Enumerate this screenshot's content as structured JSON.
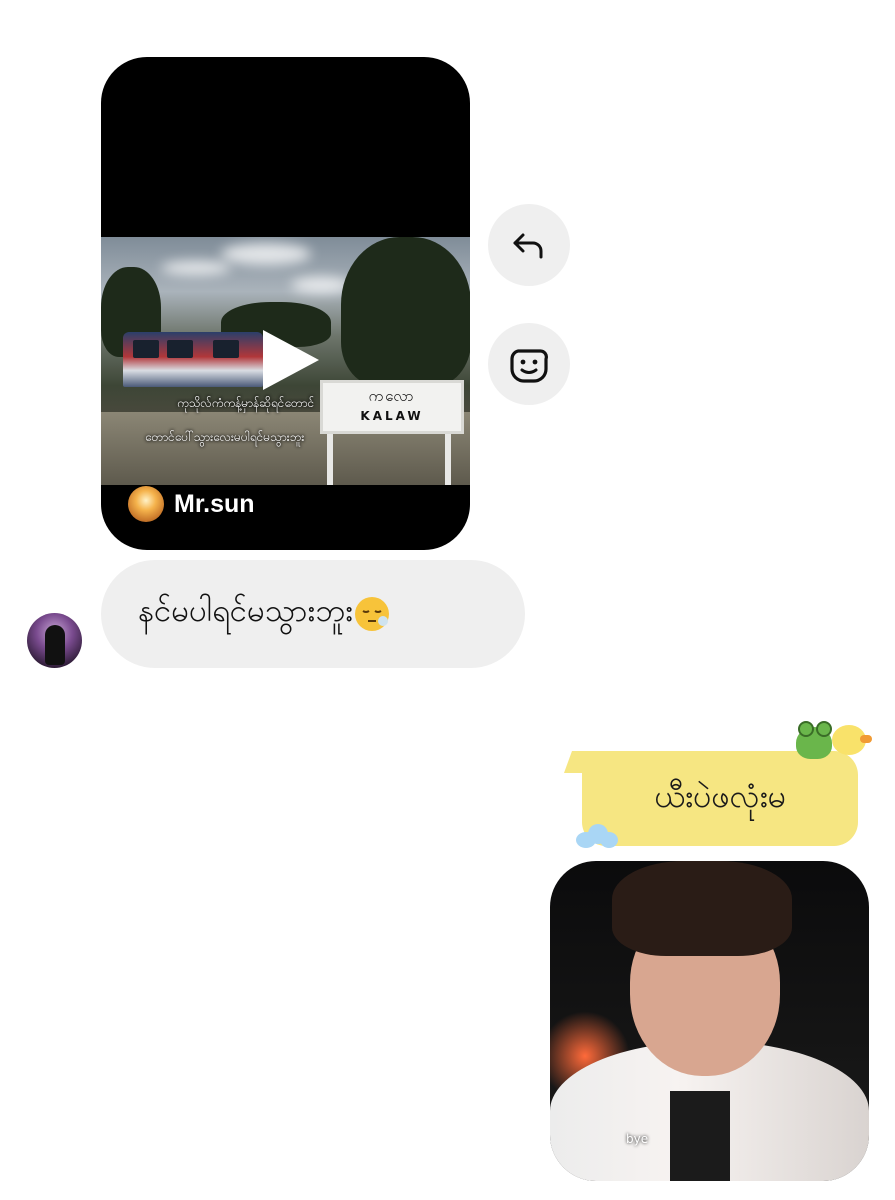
{
  "shared_post": {
    "author_name": "Mr.sun",
    "caption_line_1": "ကုသိုလ်ကံကန့်မှာန်ဆိုရင်တောင်",
    "caption_line_2": "တောင်ပေါ်သွားလေးမပါရင်မသွားဘူး",
    "sign_top": "ကလော",
    "sign_bottom": "KALAW"
  },
  "actions": {
    "reply_icon": "reply-arrow-icon",
    "react_icon": "smiley-icon"
  },
  "received_message": {
    "text": "နင်မပါရင်မသွားဘူး"
  },
  "sent_note": {
    "text": "ယီးပဲဖလုံးမ"
  },
  "sent_photo": {
    "caption": "bye"
  }
}
